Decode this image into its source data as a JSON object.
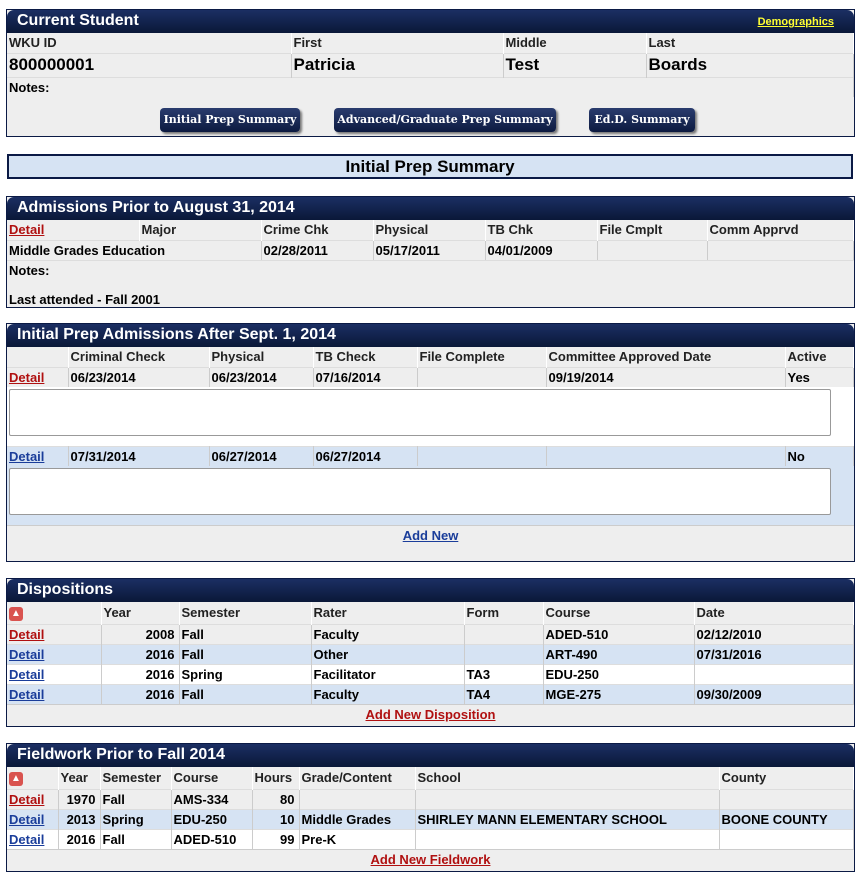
{
  "student": {
    "title": "Current Student",
    "demographics_link": "Demographics",
    "labels": {
      "id": "WKU ID",
      "first": "First",
      "middle": "Middle",
      "last": "Last",
      "notes": "Notes:"
    },
    "id": "800000001",
    "first": "Patricia",
    "middle": "Test",
    "last": "Boards",
    "buttons": [
      "Initial Prep Summary",
      "Advanced/Graduate Prep Summary",
      "Ed.D. Summary"
    ]
  },
  "summary_title": "Initial Prep Summary",
  "admissions_prior": {
    "title": "Admissions Prior to August 31, 2014",
    "columns": [
      "Detail",
      "Major",
      "Crime Chk",
      "Physical",
      "TB Chk",
      "File Cmplt",
      "Comm Apprvd"
    ],
    "row": [
      "Middle Grades Education",
      "02/28/2011",
      "05/17/2011",
      "04/01/2009",
      "",
      ""
    ],
    "notes_label": "Notes:",
    "notes_text": "Last attended - Fall 2001"
  },
  "admissions_after": {
    "title": "Initial Prep Admissions After Sept. 1, 2014",
    "columns": [
      "",
      "Criminal Check",
      "Physical",
      "TB Check",
      "File Complete",
      "Committee Approved Date",
      "Active"
    ],
    "rows": [
      {
        "link": "Detail",
        "cells": [
          "06/23/2014",
          "06/23/2014",
          "07/16/2014",
          "",
          "09/19/2014",
          "Yes"
        ]
      },
      {
        "link": "Detail",
        "cells": [
          "07/31/2014",
          "06/27/2014",
          "06/27/2014",
          "",
          "",
          "No"
        ]
      }
    ],
    "add_new": "Add New"
  },
  "dispositions": {
    "title": "Dispositions",
    "columns": [
      "",
      "Year",
      "Semester",
      "Rater",
      "Form",
      "Course",
      "Date"
    ],
    "rows": [
      {
        "link": "Detail",
        "cells": [
          "2008",
          "Fall",
          "Faculty",
          "",
          "ADED-510",
          "02/12/2010"
        ]
      },
      {
        "link": "Detail",
        "cells": [
          "2016",
          "Fall",
          "Other",
          "",
          "ART-490",
          "07/31/2016"
        ]
      },
      {
        "link": "Detail",
        "cells": [
          "2016",
          "Spring",
          "Facilitator",
          "TA3",
          "EDU-250",
          ""
        ]
      },
      {
        "link": "Detail",
        "cells": [
          "2016",
          "Fall",
          "Faculty",
          "TA4",
          "MGE-275",
          "09/30/2009"
        ]
      }
    ],
    "add_new": "Add New Disposition"
  },
  "fieldwork": {
    "title": "Fieldwork Prior to Fall 2014",
    "columns": [
      "",
      "Year",
      "Semester",
      "Course",
      "Hours",
      "Grade/Content",
      "School",
      "County"
    ],
    "rows": [
      {
        "link": "Detail",
        "cells": [
          "1970",
          "Fall",
          "AMS-334",
          "80",
          "",
          "",
          ""
        ]
      },
      {
        "link": "Detail",
        "cells": [
          "2013",
          "Spring",
          "EDU-250",
          "10",
          "Middle Grades",
          "SHIRLEY MANN ELEMENTARY SCHOOL",
          "BOONE COUNTY"
        ]
      },
      {
        "link": "Detail",
        "cells": [
          "2016",
          "Fall",
          "ADED-510",
          "99",
          "Pre-K",
          "",
          ""
        ]
      }
    ],
    "add_new": "Add New Fieldwork"
  }
}
